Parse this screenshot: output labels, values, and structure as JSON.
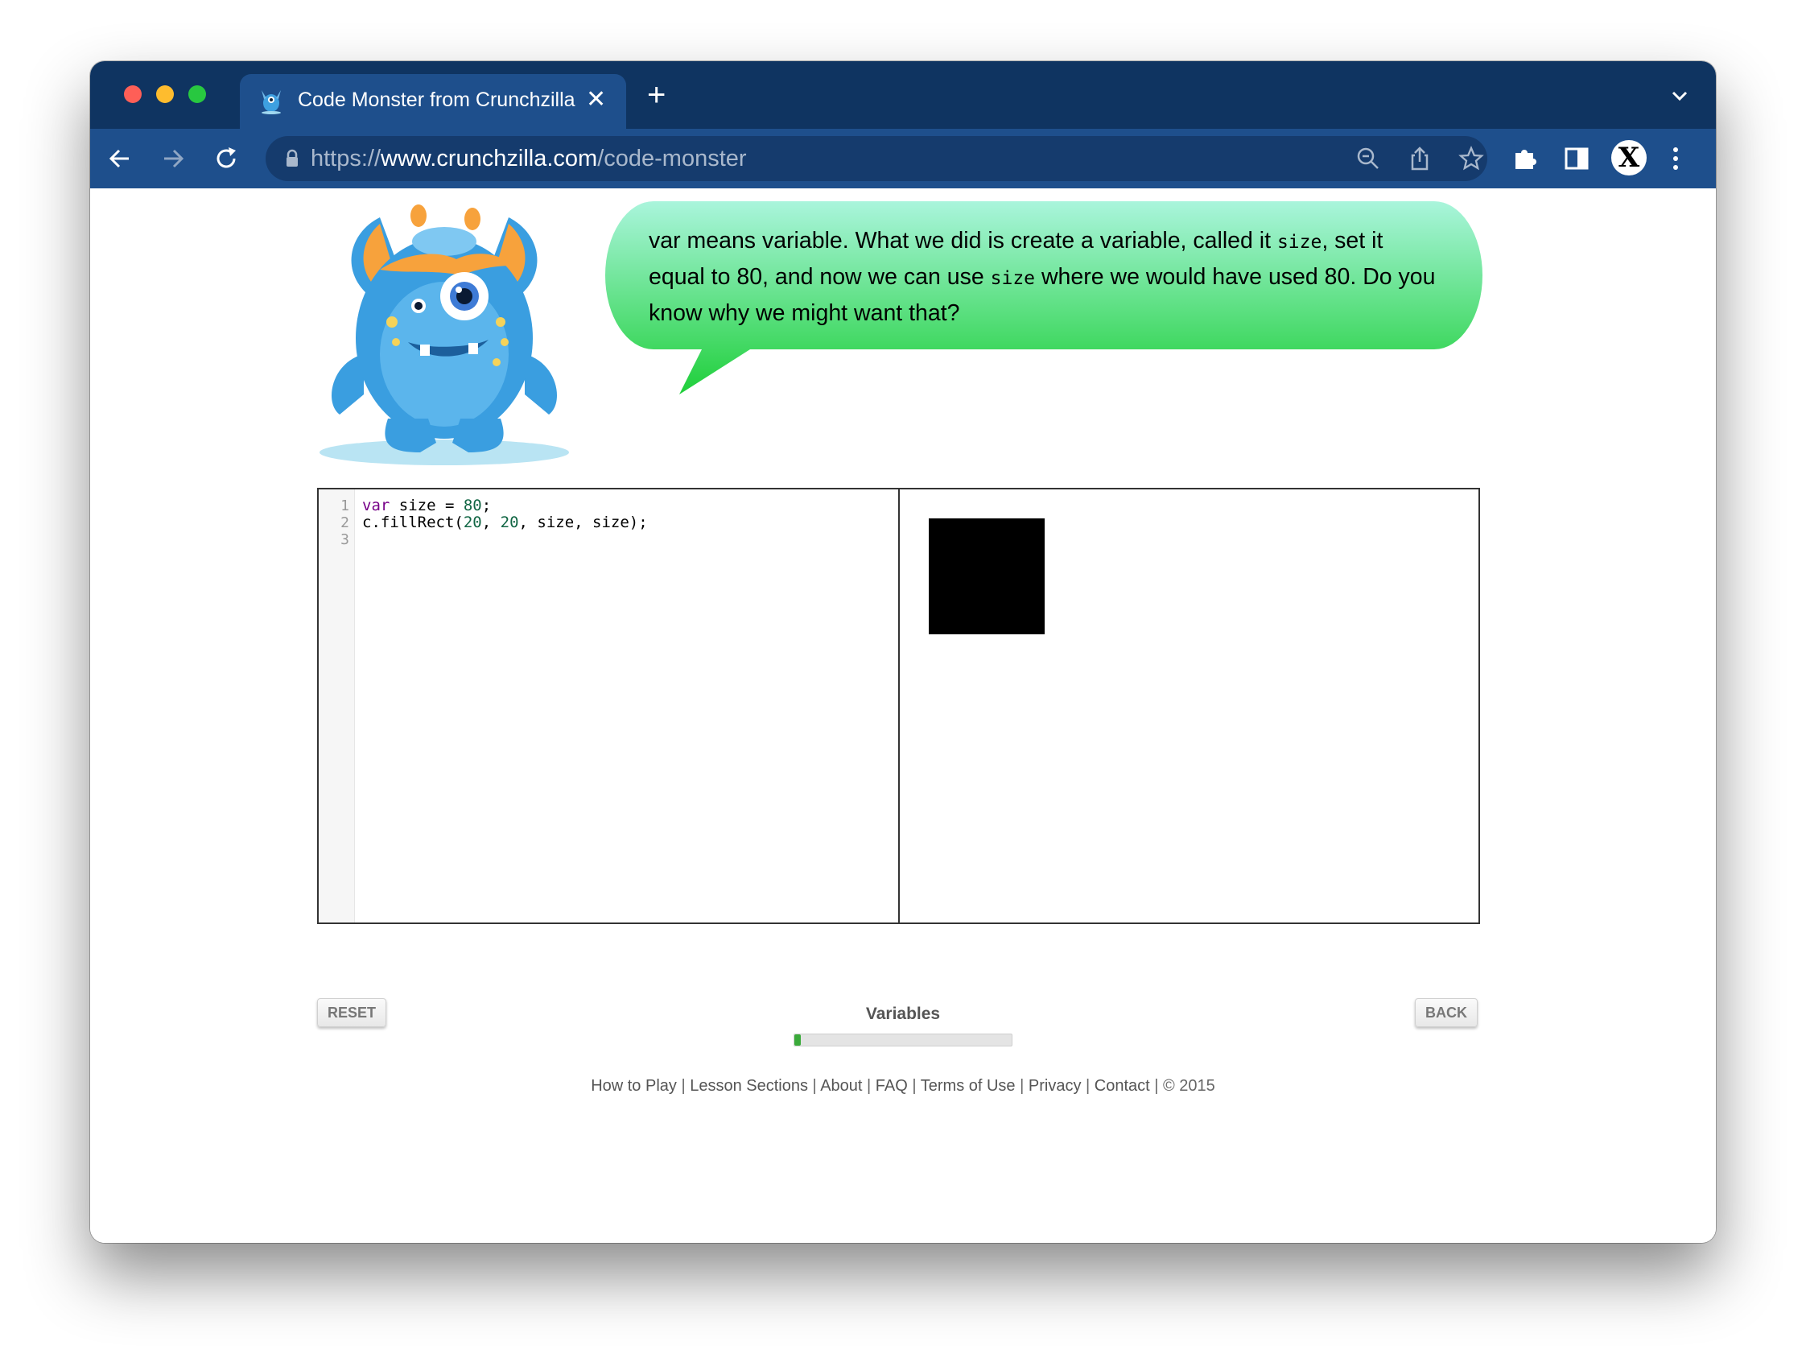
{
  "browser": {
    "tab_title": "Code Monster from Crunchzilla",
    "tab_close": "✕",
    "new_tab": "+",
    "url_scheme": "https://",
    "url_host": "www.crunchzilla.com",
    "url_path": "/code-monster",
    "profile_initial": "X"
  },
  "bubble": {
    "part1": "var means variable. What we did is create a variable, called it ",
    "code1": "size",
    "part2": ", set it equal to 80, and now we can use ",
    "code2": "size",
    "part3": " where we would have used 80. Do you know why we might want that?"
  },
  "editor": {
    "line_numbers": [
      "1",
      "2",
      "3"
    ],
    "line1": {
      "kw": "var",
      "mid": " size = ",
      "num": "80",
      "end": ";"
    },
    "line2": {
      "start": "c.fillRect(",
      "n1": "20",
      "sep1": ", ",
      "n2": "20",
      "rest": ", size, size);"
    }
  },
  "controls": {
    "reset_label": "RESET",
    "back_label": "BACK",
    "lesson_title": "Variables",
    "progress_fraction": 0.03
  },
  "footer": {
    "links": [
      "How to Play",
      "Lesson Sections",
      "About",
      "FAQ",
      "Terms of Use",
      "Privacy",
      "Contact"
    ],
    "separator": " | ",
    "copyright": "© 2015"
  },
  "colors": {
    "tabstrip": "#0f3461",
    "toolbar": "#1e4f8c",
    "bubble_top": "#aaf5dc",
    "bubble_bottom": "#1fcf3a",
    "progress": "#3aaa3a"
  }
}
